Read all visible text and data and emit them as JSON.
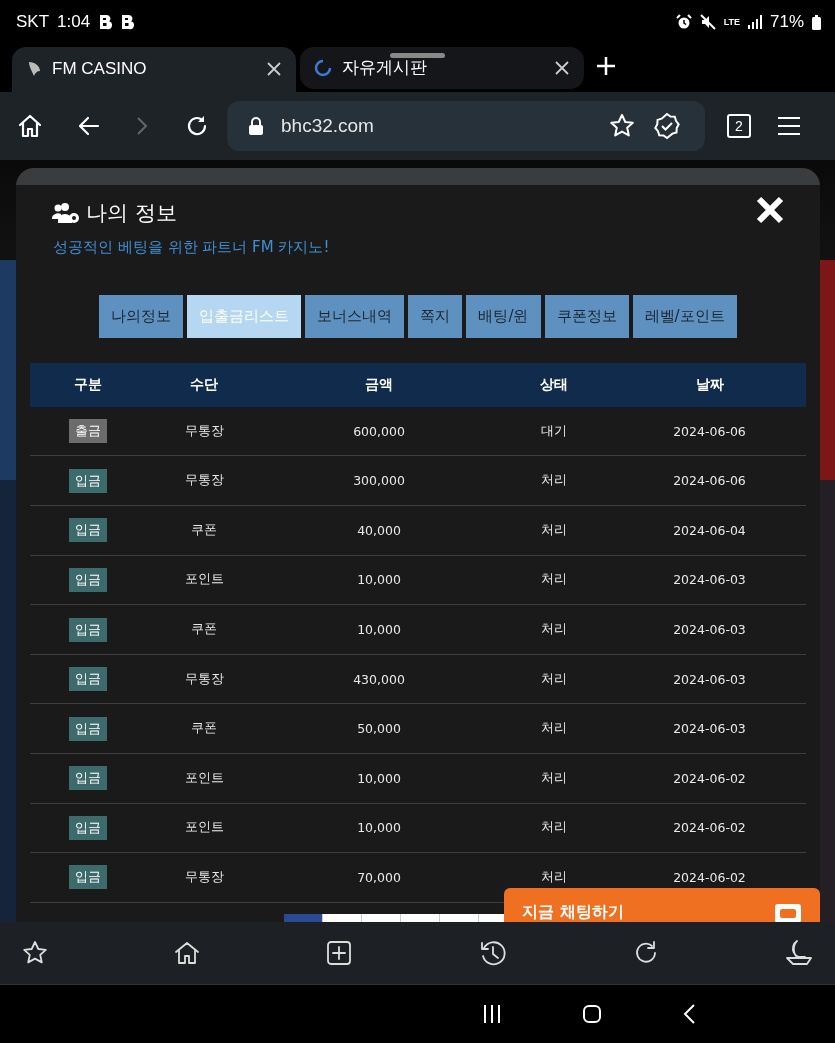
{
  "status_bar": {
    "carrier": "SKT",
    "time": "1:04",
    "network": "LTE",
    "battery": "71%"
  },
  "browser_tabs": [
    {
      "title": "FM CASINO",
      "selected": true,
      "loading": false
    },
    {
      "title": "자유게시판",
      "selected": false,
      "loading": true
    }
  ],
  "address_bar": {
    "url": "bhc32.com",
    "tab_count": "2"
  },
  "modal": {
    "title": "나의 정보",
    "subtitle": "성공적인 베팅을 위한 파트너 FM 카지노!",
    "tabs": [
      {
        "label": "나의정보",
        "selected": false
      },
      {
        "label": "입출금리스트",
        "selected": true
      },
      {
        "label": "보너스내역",
        "selected": false
      },
      {
        "label": "쪽지",
        "selected": false
      },
      {
        "label": "배팅/윈",
        "selected": false
      },
      {
        "label": "쿠폰정보",
        "selected": false
      },
      {
        "label": "레벨/포인트",
        "selected": false
      }
    ],
    "table": {
      "columns": [
        "구분",
        "수단",
        "금액",
        "상태",
        "날짜"
      ],
      "rows": [
        {
          "kind": "withdrawal",
          "type": "출금",
          "method": "무통장",
          "amount": "600,000",
          "status": "대기",
          "date": "2024-06-06"
        },
        {
          "kind": "deposit",
          "type": "입금",
          "method": "무통장",
          "amount": "300,000",
          "status": "처리",
          "date": "2024-06-06"
        },
        {
          "kind": "deposit",
          "type": "입금",
          "method": "쿠폰",
          "amount": "40,000",
          "status": "처리",
          "date": "2024-06-04"
        },
        {
          "kind": "deposit",
          "type": "입금",
          "method": "포인트",
          "amount": "10,000",
          "status": "처리",
          "date": "2024-06-03"
        },
        {
          "kind": "deposit",
          "type": "입금",
          "method": "쿠폰",
          "amount": "10,000",
          "status": "처리",
          "date": "2024-06-03"
        },
        {
          "kind": "deposit",
          "type": "입금",
          "method": "무통장",
          "amount": "430,000",
          "status": "처리",
          "date": "2024-06-03"
        },
        {
          "kind": "deposit",
          "type": "입금",
          "method": "쿠폰",
          "amount": "50,000",
          "status": "처리",
          "date": "2024-06-03"
        },
        {
          "kind": "deposit",
          "type": "입금",
          "method": "포인트",
          "amount": "10,000",
          "status": "처리",
          "date": "2024-06-02"
        },
        {
          "kind": "deposit",
          "type": "입금",
          "method": "포인트",
          "amount": "10,000",
          "status": "처리",
          "date": "2024-06-02"
        },
        {
          "kind": "deposit",
          "type": "입금",
          "method": "무통장",
          "amount": "70,000",
          "status": "처리",
          "date": "2024-06-02"
        }
      ]
    }
  },
  "chat_button": {
    "label": "지금 채팅하기"
  }
}
